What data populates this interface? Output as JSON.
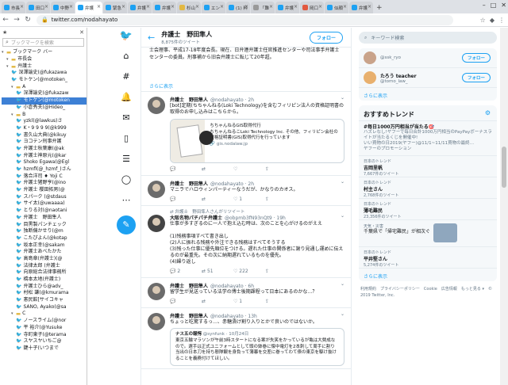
{
  "browser": {
    "tabs": [
      {
        "label": "市長",
        "color": "#1da1f2"
      },
      {
        "label": "田口",
        "color": "#1da1f2"
      },
      {
        "label": "中野",
        "color": "#1da1f2"
      },
      {
        "label": "弁護",
        "color": "#1da1f2",
        "active": true
      },
      {
        "label": "緊急",
        "color": "#1da1f2"
      },
      {
        "label": "弁護",
        "color": "#1da1f2"
      },
      {
        "label": "弁護",
        "color": "#1da1f2"
      },
      {
        "label": "杉山",
        "color": "#e2b842"
      },
      {
        "label": "エン",
        "color": "#1da1f2"
      },
      {
        "label": "(1) 料",
        "color": "#1da1f2"
      },
      {
        "label": "「難",
        "color": "#999999"
      },
      {
        "label": "弁護",
        "color": "#1da1f2"
      },
      {
        "label": "岡口",
        "color": "#e2583e"
      },
      {
        "label": "似顔",
        "color": "#1da1f2"
      },
      {
        "label": "弁護",
        "color": "#1da1f2"
      }
    ],
    "url": "twitter.com/nodahayato"
  },
  "bookmarks": {
    "search_placeholder": "ブックマークを検索",
    "rows": [
      {
        "label": "ブックマーク バー",
        "type": "folder",
        "indent": 0
      },
      {
        "label": "市長会",
        "type": "folder",
        "indent": 1
      },
      {
        "label": "弁護士",
        "type": "folder",
        "indent": 1
      },
      {
        "label": "深澤諭史(@fukazawa",
        "type": "tw",
        "indent": 2
      },
      {
        "label": "モトケン(@motoken_",
        "type": "tw",
        "indent": 2
      },
      {
        "label": "A",
        "type": "folder",
        "indent": 2
      },
      {
        "label": "深澤諭史(@fukazaw",
        "type": "tw",
        "indent": 3
      },
      {
        "label": "モトケン(@motoken",
        "type": "tw",
        "indent": 3,
        "selected": true
      },
      {
        "label": "小倉秀夫(@Hideo_",
        "type": "tw",
        "indent": 3
      },
      {
        "label": "B",
        "type": "folder",
        "indent": 2
      },
      {
        "label": "yzkl(@lawkus)さ",
        "type": "tw",
        "indent": 3
      },
      {
        "label": "K・9 9 9 9(@k999",
        "type": "tw",
        "indent": 3
      },
      {
        "label": "書久山大典(@kikuy",
        "type": "tw",
        "indent": 3
      },
      {
        "label": "ヨコテン刑事弁護",
        "type": "tw",
        "indent": 3
      },
      {
        "label": "弁護士秋葉康(@ak",
        "type": "tw",
        "indent": 3
      },
      {
        "label": "弁護士神原元(@kar",
        "type": "tw",
        "indent": 3
      },
      {
        "label": "Shoko Egawa(@Egl",
        "type": "tw",
        "indent": 3
      },
      {
        "label": "hzmfl(@_hzmf_)さん",
        "type": "tw",
        "indent": 3
      },
      {
        "label": "落合洋司 ♦ Yoji C",
        "type": "tw",
        "indent": 3
      },
      {
        "label": "弁護士猪野亨(@ino",
        "type": "tw",
        "indent": 3
      },
      {
        "label": "弁護士 櫻田拓男(@",
        "type": "tw",
        "indent": 3
      },
      {
        "label": "スパ一ク (@stdaus",
        "type": "tw",
        "indent": 3
      },
      {
        "label": "サイ太(@uwaaaa)",
        "type": "tw",
        "indent": 3
      },
      {
        "label": "とりる対(@naotani",
        "type": "tw",
        "indent": 3
      },
      {
        "label": "弁護士　野田隼人",
        "type": "tw",
        "indent": 3
      },
      {
        "label": "目黒製パンチェック",
        "type": "tw",
        "indent": 3
      },
      {
        "label": "独断偏かせり(@m",
        "type": "tw",
        "indent": 3
      },
      {
        "label": "こたぴよん(@kotap",
        "type": "tw",
        "indent": 3
      },
      {
        "label": "坂本正幸(@sakam",
        "type": "tw",
        "indent": 3
      },
      {
        "label": "弁護士あべたかた",
        "type": "tw",
        "indent": 3
      },
      {
        "label": "高島章(弁護士)(@",
        "type": "tw",
        "indent": 3
      },
      {
        "label": "法律太郎 (弁護士",
        "type": "tw",
        "indent": 3
      },
      {
        "label": "向原総合法律事務所",
        "type": "tw",
        "indent": 3
      },
      {
        "label": "橋本太地(弁護士)",
        "type": "tw",
        "indent": 3
      },
      {
        "label": "弁護士ひら@adv_",
        "type": "tw",
        "indent": 3
      },
      {
        "label": "村松 謙(@kmurama",
        "type": "tw",
        "indent": 3
      },
      {
        "label": "憲民館[サイコキャ",
        "type": "tw",
        "indent": 3
      },
      {
        "label": "SANO, Ayako(@sa",
        "type": "tw",
        "indent": 3
      },
      {
        "label": "C",
        "type": "folder",
        "indent": 2
      },
      {
        "label": "ノースライム(@nor",
        "type": "tw",
        "indent": 3
      },
      {
        "label": "平 裕介(@Yusuke",
        "type": "tw",
        "indent": 3
      },
      {
        "label": "寺町東子(@terama",
        "type": "tw",
        "indent": 3
      },
      {
        "label": "スヤスヤいちご@",
        "type": "tw",
        "indent": 3
      },
      {
        "label": "鍵十子(いつまで",
        "type": "tw",
        "indent": 3
      }
    ]
  },
  "profile": {
    "name": "弁護士　野田隼人",
    "tweet_count": "8,875件のツイート",
    "follow_label": "フォロー",
    "bio": "士会理事、平成17-18年度会長。現在、日弁連弁護士任官推進センターや司法事手弁護士センターの委員。刑事補から旧会弁護士に転じて20年超。",
    "show_more": "さらに表示"
  },
  "tweets": [
    {
      "name": "弁護士　野田隼人",
      "handle": "@nodahayato · 2h",
      "body": "[bot]定期(ちちゃんねる(Loki Technology)を含むフィリピン法人の資格証明書の取得のお申し込みはこちらから。",
      "card_title": "ちちゃんねるGIS取得代行",
      "card_desc": "ちちゃんねるこLoki Technology Inc. その他、フィリピン会社の資格証明書(GIS)取得代行を行っています",
      "card_url": "🔗 gis.nodalaw.jp",
      "reply": "",
      "rt": "",
      "like": ""
    },
    {
      "name": "弁護士　野田隼人",
      "handle": "@nodahayato · 2h",
      "body": "マニラでハロウィンパーティーなうだが、かなりのカオス。",
      "reply": "",
      "rt": "",
      "like": "1"
    },
    {
      "retweet_line": "弁護士　野田隼人さんがリツイート",
      "name": "大阪名物パチパチ弁護士",
      "handle": "@obpmb3fN93nQt9 · 19h",
      "body": "仕事が多すぎるのに一人で抱え込む時は、次のことを心がけるのがええ\n\n(1)残務事項すべて書き出し\n(2)人に振れる残務や外注できる残務はすべてそうする\n(3)残った仕事に優先順位をつける。遅れた仕事の関係者に謝り見通し運めに伝えるのが最重先。その次に納期遅れているものを優先。\n(4)繰り返し",
      "reply": "2",
      "rt": "51",
      "like": "222"
    },
    {
      "name": "弁護士　野田隼人",
      "handle": "@nodahayato · 6h",
      "body": "留学生が見送っている法学の博士後期課程って日本にあるのかな…？",
      "reply": "",
      "rt": "",
      "like": "1"
    },
    {
      "name": "弁護士　野田隼人",
      "handle": "@nodahayato · 13h",
      "body": "ちょっと吃驚するっ…、赤糖漬け割り入りとかで良いのではないか。",
      "quote_name": "ナス五の報愕",
      "quote_handle": "@synfunk · 10月24日",
      "quote_body": "東京五輪マラソンが午前3時スタートになる案が失笑をかっているが亀は大賛成なので。選手は正式ユニフォームとして頭の鉢巻に懐中電灯を2本刺して周手に割り当出の日本刀を持ち懸隊観を身負って薄暮を交差に巻ってわて俵の東京を駆け抜けることを義務付けてほしい。"
    }
  ],
  "right": {
    "search_placeholder": "キーワード検索",
    "users": [
      {
        "name": "",
        "handle": "@ssk_ryo",
        "follow": "フォロー"
      },
      {
        "name": "たろう teacher",
        "handle": "@tomo_law_",
        "follow": "フォロー"
      }
    ],
    "users_more": "さらに表示",
    "trends_title": "おすすめトレンド",
    "promo": {
      "title": "#毎日1000万円相当が当たる🎯",
      "desc": "ハズレなし!ヤフーで毎日合計1000万円相当のPayPayボーナスライトが当たるくじを開催中!",
      "by": "いい買物の日2019(ヤフー)@11/1~11/11買物の最終…",
      "promoted": "ヤフーのプロモーション"
    },
    "trends": [
      {
        "category": "日本のトレンド",
        "name": "吉岡里帆",
        "count": "7,667件のツイート"
      },
      {
        "category": "日本のトレンド",
        "name": "村主さん",
        "count": "2,768件のツイート"
      },
      {
        "category": "日本のトレンド",
        "name": "薄毛難民",
        "count": "23,356件のツイート"
      }
    ],
    "news": {
      "tag": "天気・災害",
      "body": "千葉県で「帰宅難民」が相次ぐ"
    },
    "trend_last": {
      "category": "日本のトレンド",
      "name": "平井堅さん",
      "count": "5,274件のツイート"
    },
    "trends_more": "さらに表示",
    "footer": "利用規約　プライバシーポリシー　Cookie　広告情報　もっと見る ▾　© 2019 Twitter, Inc."
  }
}
